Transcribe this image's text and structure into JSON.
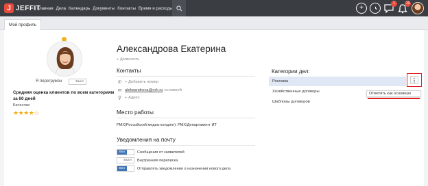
{
  "brand": {
    "logo_mark": "J",
    "name": "JEFFIT"
  },
  "nav": {
    "items": [
      "Главная",
      "Дела",
      "Календарь",
      "Документы",
      "Контакты",
      "Время и расходы"
    ],
    "search_icon": "search-icon"
  },
  "top_icons": {
    "add": "+",
    "clock": "◷",
    "chat_badge": "1",
    "bell_badge": "19"
  },
  "tabs": [
    "Мой профиль"
  ],
  "profile": {
    "name": "Александрова Екатерина",
    "position_placeholder": "+ Должность",
    "overload_label": "Я перегружен",
    "overload_toggle": "Выкл",
    "rating_title": "Средняя оценка клиентов по всем категориям за 60 дней",
    "quality_label": "Качество",
    "stars": "★★★★☆",
    "rating_value": 4
  },
  "contacts": {
    "title": "Контакты",
    "phone_add": "+ Добавить номер",
    "email": "aleksandrova@rnh.ru",
    "email_tag": "основной",
    "address_add": "+ Адрес"
  },
  "workplace": {
    "title": "Место работы",
    "value": "РМХ(Российский медиа-холдинг): РМХ/Департамент ИТ"
  },
  "notifications": {
    "title": "Уведомления на почту",
    "items": [
      {
        "label": "Сообщения от заявителей",
        "state": "Вкл"
      },
      {
        "label": "Внутренняя переписка",
        "state": "Выкл"
      },
      {
        "label": "Отправлять уведомления о назначении нового дела",
        "state": "Вкл"
      }
    ]
  },
  "categories": {
    "title": "Категории дел:",
    "items": [
      "Реклама",
      "Хозяйственные договоры",
      "Шаблоны договоров"
    ],
    "selected_index": 0,
    "menu_icon": "⋮",
    "popup_label": "Отметить как основную"
  },
  "colors": {
    "accent": "#3f74b6",
    "highlight": "#e02020",
    "topbar": "#3a3d42"
  }
}
